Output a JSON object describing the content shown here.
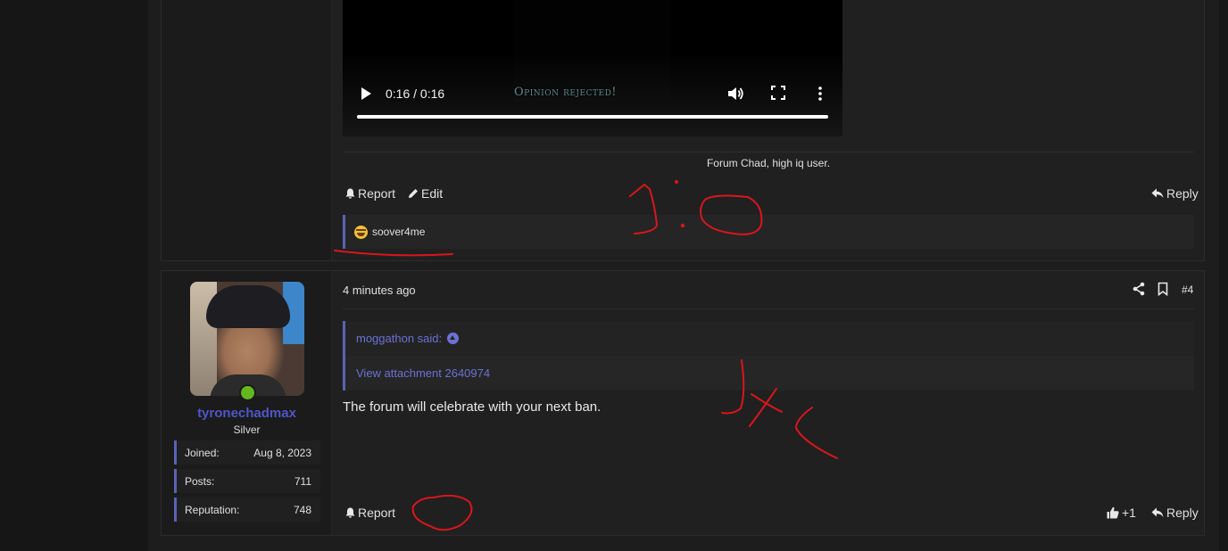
{
  "post1": {
    "video": {
      "time": "0:16 / 0:16",
      "caption": "Opinion rejected!",
      "progress": 1.0
    },
    "signature": "Forum Chad, high iq user.",
    "actions": {
      "report": "Report",
      "edit": "Edit",
      "reply": "Reply"
    },
    "reaction": {
      "icon": "laughing-tears-emoji-icon",
      "text": "soover4me"
    }
  },
  "post2": {
    "timestamp": "4 minutes ago",
    "post_number": "#4",
    "user": {
      "name": "tyronechadmax",
      "title": "Silver",
      "online": true,
      "stats": [
        {
          "label": "Joined:",
          "value": "Aug 8, 2023"
        },
        {
          "label": "Posts:",
          "value": "711"
        },
        {
          "label": "Reputation:",
          "value": "748"
        }
      ]
    },
    "quote": {
      "author": "moggathon said:",
      "attachment_link": "View attachment 2640974"
    },
    "message": "The forum will celebrate with your next ban.",
    "actions": {
      "report": "Report",
      "reaction_count": "+1",
      "reply": "Reply"
    }
  },
  "colors": {
    "background": "#161616",
    "panel": "#202020",
    "accent": "#5b62b4",
    "link": "#6a72d4",
    "online": "#63b81e",
    "annotation_red": "#d9161c"
  }
}
